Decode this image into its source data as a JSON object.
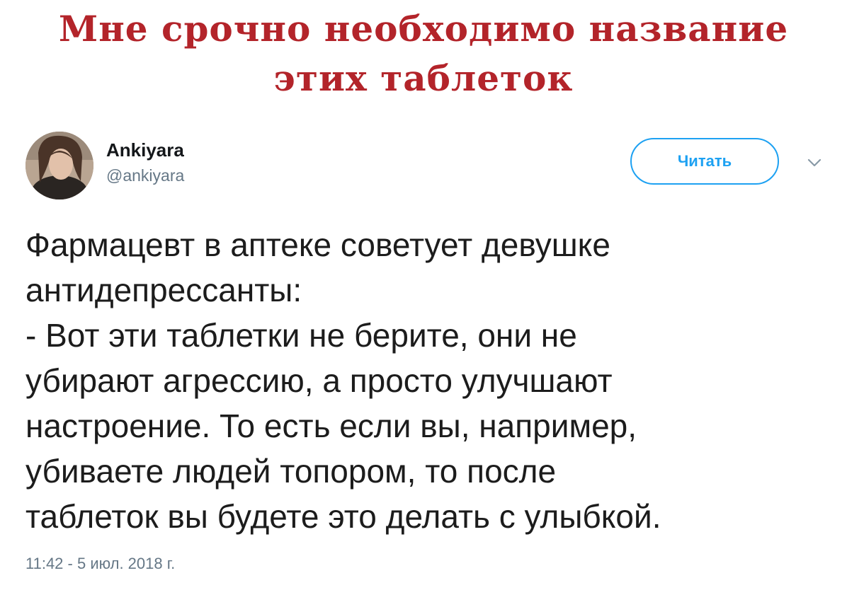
{
  "meme": {
    "title_line1": "Мне срочно необходимо название",
    "title_line2": "этих таблеток",
    "title_color": "#b3242a"
  },
  "tweet": {
    "author_name": "Ankiyara",
    "author_handle": "@ankiyara",
    "follow_label": "Читать",
    "menu_icon": "chevron-down-icon",
    "text": "Фармацевт в аптеке советует девушке\nантидепрессанты:\n- Вот эти таблетки не берите, они не\nубирают агрессию, а просто улучшают\nнастроение. То есть если вы, например,\nубиваете людей топором, то после\nтаблеток вы будете это делать с улыбкой.",
    "timestamp": "11:42 - 5 июл. 2018 г.",
    "accent_color": "#1da1f2"
  }
}
